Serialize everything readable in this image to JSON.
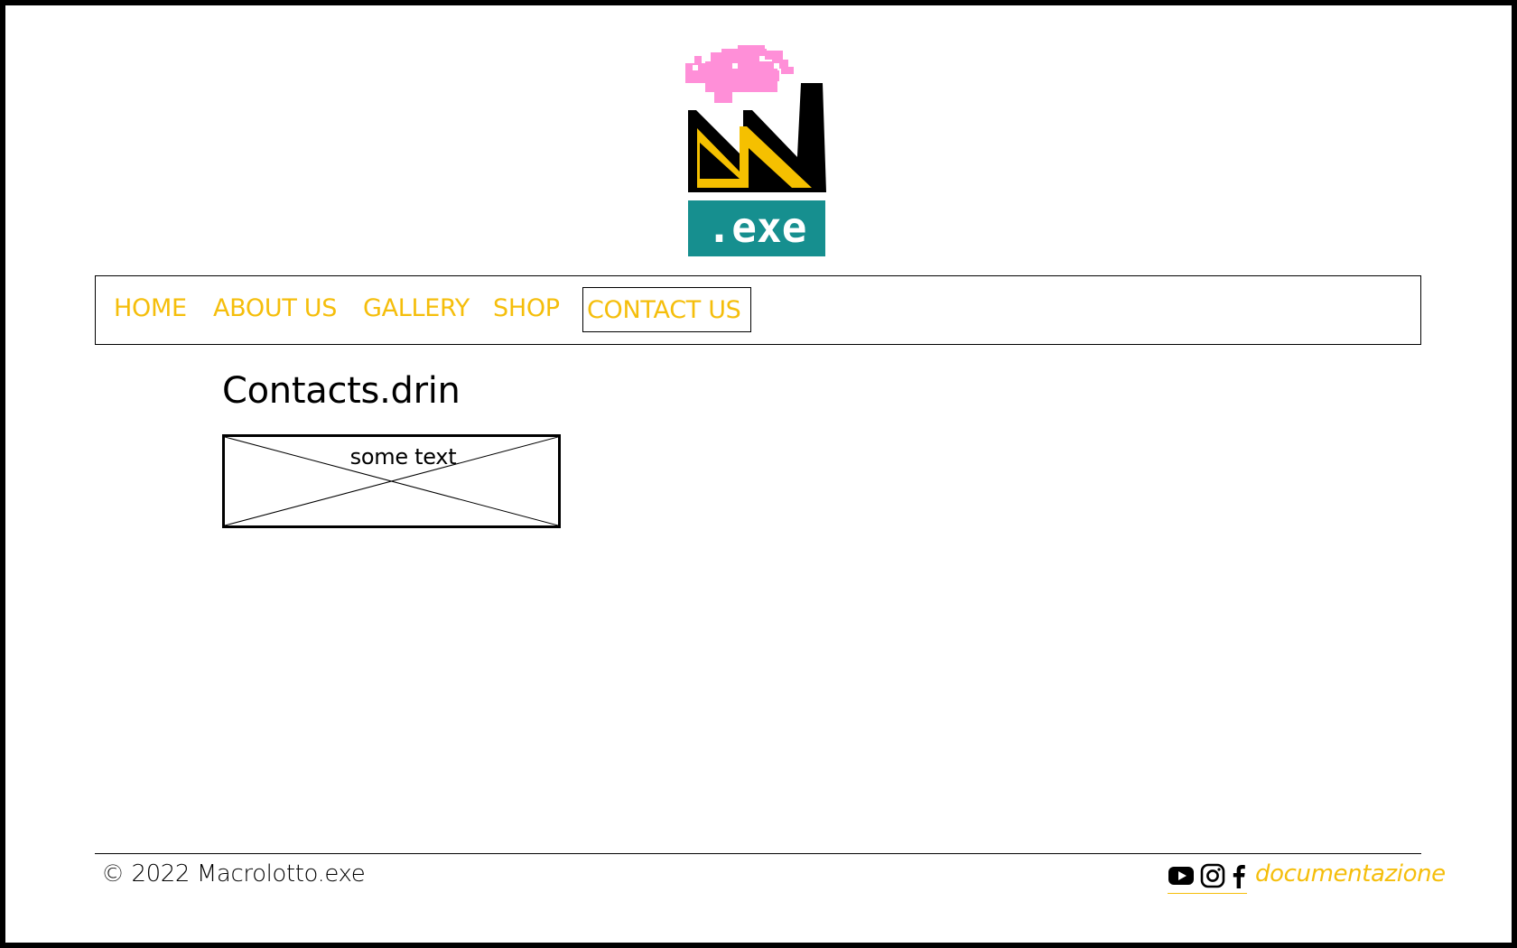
{
  "brand": {
    "logo_icon": "macrolotto-exe-factory-logo",
    "logo_text": ".exe",
    "colors": {
      "accent": "#f5be0b",
      "smoke": "#ff8fd8",
      "teal": "#168f8f",
      "black": "#000000"
    }
  },
  "nav": {
    "items": [
      {
        "label": "HOME"
      },
      {
        "label": "ABOUT US"
      },
      {
        "label": "GALLERY"
      },
      {
        "label": "SHOP"
      },
      {
        "label": "CONTACT US"
      }
    ],
    "active_index": 4
  },
  "main": {
    "title": "Contacts.drin",
    "placeholder_text": "some text",
    "placeholder_icon": "image-placeholder-icon"
  },
  "footer": {
    "copyright": "© 2022 Macrolotto.exe",
    "social": [
      {
        "icon": "youtube-icon"
      },
      {
        "icon": "instagram-icon"
      },
      {
        "icon": "facebook-icon"
      }
    ],
    "docs_link": "documentazione"
  }
}
